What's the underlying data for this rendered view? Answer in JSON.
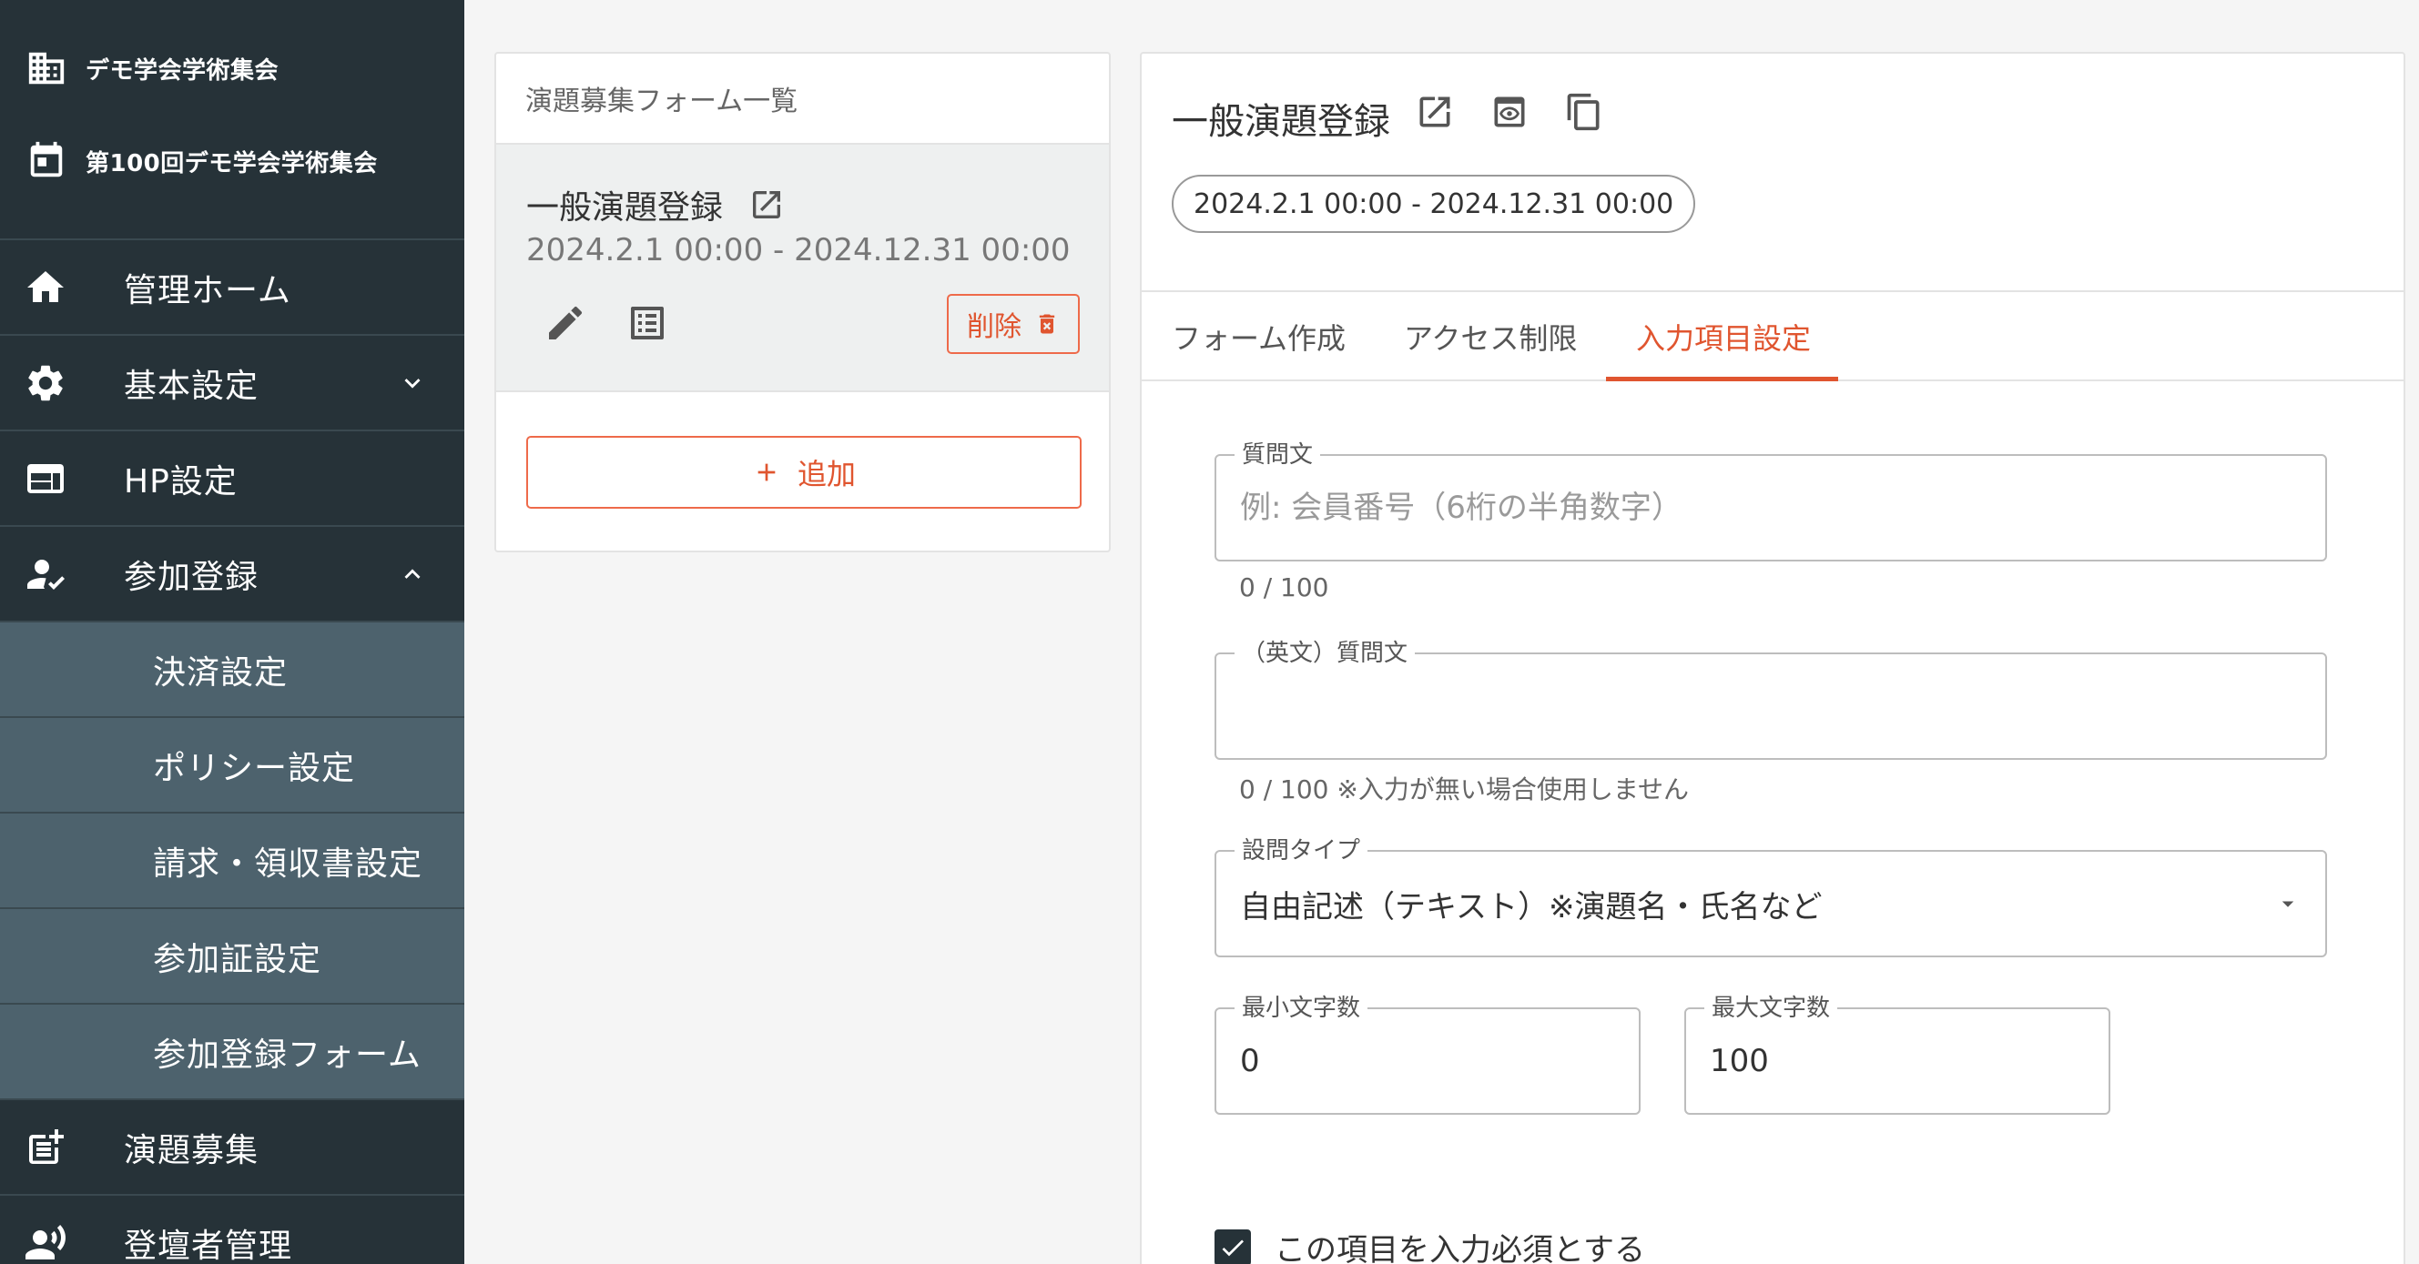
{
  "sidebar": {
    "org_name": "デモ学会学術集会",
    "event_name": "第100回デモ学会学術集会",
    "items": [
      {
        "label": "管理ホーム"
      },
      {
        "label": "基本設定"
      },
      {
        "label": "HP設定"
      },
      {
        "label": "参加登録"
      },
      {
        "label": "決済設定"
      },
      {
        "label": "ポリシー設定"
      },
      {
        "label": "請求・領収書設定"
      },
      {
        "label": "参加証設定"
      },
      {
        "label": "参加登録フォーム"
      },
      {
        "label": "演題募集"
      },
      {
        "label": "登壇者管理"
      }
    ]
  },
  "list_panel": {
    "header": "演題募集フォーム一覧",
    "item": {
      "title": "一般演題登録",
      "date_range": "2024.2.1 00:00 - 2024.12.31 00:00",
      "delete_label": "削除"
    },
    "add_label": "追加"
  },
  "detail": {
    "title": "一般演題登録",
    "date_range": "2024.2.1 00:00 - 2024.12.31 00:00",
    "tabs": [
      {
        "label": "フォーム作成"
      },
      {
        "label": "アクセス制限"
      },
      {
        "label": "入力項目設定"
      }
    ],
    "question": {
      "label": "質問文",
      "placeholder": "例: 会員番号（6桁の半角数字）",
      "value": "",
      "counter": "0 / 100"
    },
    "question_en": {
      "label": "（英文）質問文",
      "value": "",
      "counter": "0 / 100 ※入力が無い場合使用しません"
    },
    "question_type": {
      "label": "設問タイプ",
      "value": "自由記述（テキスト）※演題名・氏名など"
    },
    "min_chars": {
      "label": "最小文字数",
      "value": "0"
    },
    "max_chars": {
      "label": "最大文字数",
      "value": "100"
    },
    "required": {
      "label": "この項目を入力必須とする",
      "checked": true
    }
  },
  "colors": {
    "sidebar_bg": "#263238",
    "sidebar_sub_bg": "#4d626d",
    "accent": "#e0552f"
  }
}
